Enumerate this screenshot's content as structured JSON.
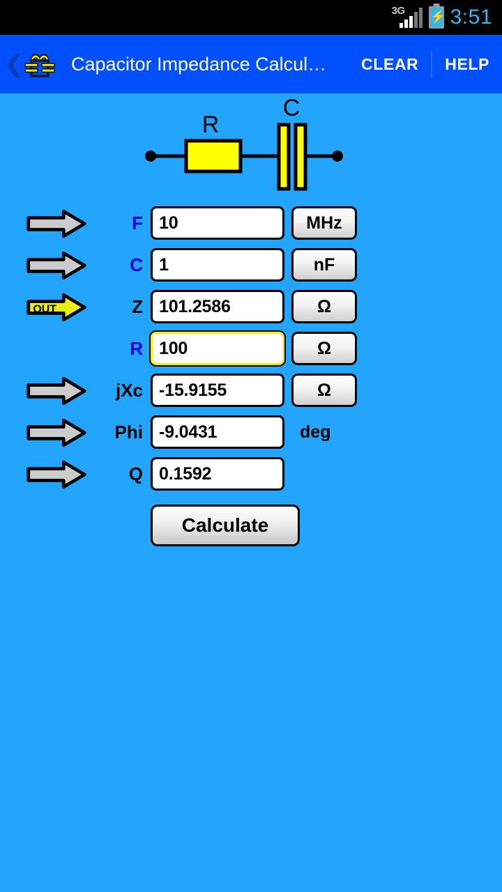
{
  "status_bar": {
    "network_type": "3G",
    "time": "3:51",
    "battery_state": "charging",
    "clock_color": "#33b5e5",
    "signal_bars_active": 3,
    "signal_bars_total": 5
  },
  "action_bar": {
    "up_label": "❮",
    "title": "Capacitor Impedance Calcul…",
    "clear_label": "CLEAR",
    "help_label": "HELP",
    "background_color": "#0050ff"
  },
  "circuit": {
    "resistor_label": "R",
    "capacitor_label": "C",
    "element_fill": "#ffff00",
    "wire_color": "#000000"
  },
  "theme": {
    "background_color": "#24a5fd",
    "input_label_color": "#0000ee",
    "output_label_color": "#000000",
    "focus_border_color": "#f5ef18",
    "out_arrow_color": "#ebec12",
    "arrow_color": "#cccccc"
  },
  "form": {
    "rows": [
      {
        "marker": "arrow",
        "label": "F",
        "label_kind": "in",
        "value": "10",
        "unit": "MHz",
        "unit_kind": "button",
        "focused": false
      },
      {
        "marker": "arrow",
        "label": "C",
        "label_kind": "in",
        "value": "1",
        "unit": "nF",
        "unit_kind": "button",
        "focused": false
      },
      {
        "marker": "out",
        "label": "Z",
        "label_kind": "out",
        "value": "101.2586",
        "unit": "Ω",
        "unit_kind": "button",
        "focused": false
      },
      {
        "marker": "none",
        "label": "R",
        "label_kind": "in",
        "value": "100",
        "unit": "Ω",
        "unit_kind": "button",
        "focused": true
      },
      {
        "marker": "arrow",
        "label": "jXc",
        "label_kind": "out",
        "value": "-15.9155",
        "unit": "Ω",
        "unit_kind": "button",
        "focused": false
      },
      {
        "marker": "arrow",
        "label": "Phi",
        "label_kind": "out",
        "value": "-9.0431",
        "unit": "deg",
        "unit_kind": "text",
        "focused": false
      },
      {
        "marker": "arrow",
        "label": "Q",
        "label_kind": "out",
        "value": "0.1592",
        "unit": "",
        "unit_kind": "none",
        "focused": false
      }
    ],
    "out_marker_text": "OUT",
    "calculate_label": "Calculate"
  }
}
